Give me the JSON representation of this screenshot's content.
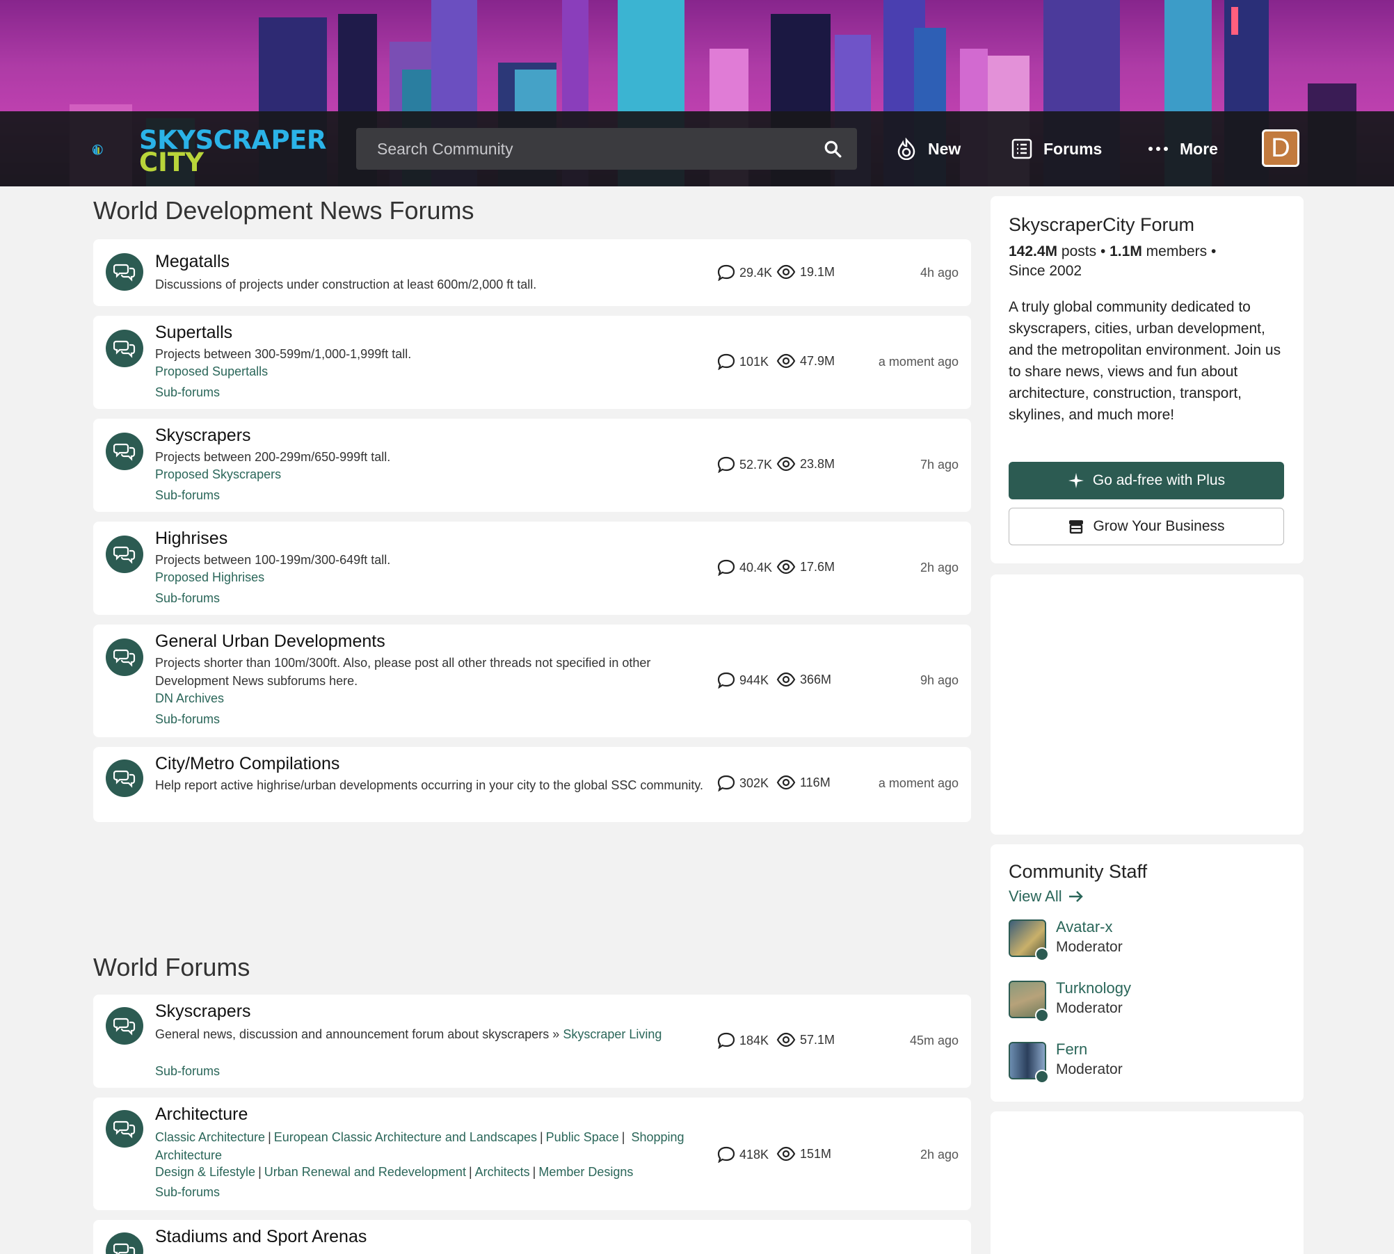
{
  "header": {
    "logo_line1": "SKYSCRAPER",
    "logo_line2": "CITY",
    "search_placeholder": "Search Community",
    "nav": {
      "new": "New",
      "forums": "Forums",
      "more": "More"
    },
    "avatar_letter": "D"
  },
  "sections": [
    {
      "title": "World Development News Forums",
      "forums": [
        {
          "title": "Megatalls",
          "desc": "Discussions of projects under construction at least 600m/2,000 ft tall.",
          "link": "",
          "subforums": "",
          "threads": "29.4K",
          "views": "19.1M",
          "time": "4h ago"
        },
        {
          "title": "Supertalls",
          "desc": "Projects between 300-599m/1,000-1,999ft tall.",
          "link": "Proposed Supertalls",
          "subforums": "Sub-forums",
          "threads": "101K",
          "views": "47.9M",
          "time": "a moment ago"
        },
        {
          "title": "Skyscrapers",
          "desc": "Projects between 200-299m/650-999ft tall.",
          "link": "Proposed Skyscrapers",
          "subforums": "Sub-forums",
          "threads": "52.7K",
          "views": "23.8M",
          "time": "7h ago"
        },
        {
          "title": "Highrises",
          "desc": "Projects between 100-199m/300-649ft tall.",
          "link": "Proposed Highrises",
          "subforums": "Sub-forums",
          "threads": "40.4K",
          "views": "17.6M",
          "time": "2h ago"
        },
        {
          "title": "General Urban Developments",
          "desc": "Projects shorter than 100m/300ft. Also, please post all other threads not specified in other Development News subforums here.",
          "link": "DN Archives",
          "subforums": "Sub-forums",
          "threads": "944K",
          "views": "366M",
          "time": "9h ago"
        },
        {
          "title": "City/Metro Compilations",
          "desc": "Help report active highrise/urban developments occurring in your city to the global SSC community.",
          "link": "",
          "subforums": "",
          "threads": "302K",
          "views": "116M",
          "time": "a moment ago"
        }
      ]
    },
    {
      "title": "World Forums",
      "forums": [
        {
          "title": "Skyscrapers",
          "desc": "General news, discussion and announcement forum about skyscrapers »",
          "desc_link": "Skyscraper Living",
          "subforums": "Sub-forums",
          "threads": "184K",
          "views": "57.1M",
          "time": "45m ago"
        },
        {
          "title": "Architecture",
          "links_line1": [
            "Classic Architecture",
            "European Classic Architecture and Landscapes",
            "Public Space",
            "Shopping Architecture"
          ],
          "links_line2": [
            "Design & Lifestyle",
            "Urban Renewal and Redevelopment",
            "Architects",
            "Member Designs"
          ],
          "subforums": "Sub-forums",
          "threads": "418K",
          "views": "151M",
          "time": "2h ago"
        },
        {
          "title": "Stadiums and Sport Arenas"
        }
      ]
    }
  ],
  "sidebar": {
    "about": {
      "title": "SkyscraperCity Forum",
      "posts_value": "142.4M",
      "posts_label": "posts",
      "members_value": "1.1M",
      "members_label": "members",
      "since": "Since 2002",
      "description": "A truly global community dedicated to skyscrapers, cities, urban development, and the metropolitan environment. Join us to share news, views and fun about architecture, construction, transport, skylines, and much more!",
      "btn_plus": "Go ad-free with Plus",
      "btn_business": "Grow Your Business"
    },
    "staff": {
      "title": "Community Staff",
      "view_all": "View All",
      "members": [
        {
          "name": "Avatar-x",
          "role": "Moderator"
        },
        {
          "name": "Turknology",
          "role": "Moderator"
        },
        {
          "name": "Fern",
          "role": "Moderator"
        }
      ]
    }
  },
  "colors": {
    "accent": "#2c5b52",
    "link": "#2a6659",
    "navbar": "#18181c"
  }
}
